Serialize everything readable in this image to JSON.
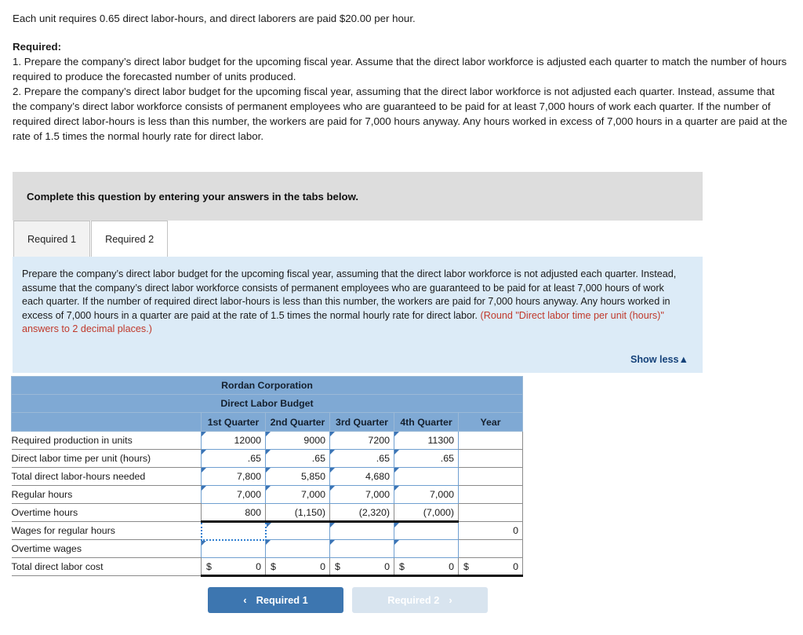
{
  "problem": {
    "intro": "Each unit requires 0.65 direct labor-hours, and direct laborers are paid $20.00 per hour.",
    "required_heading": "Required:",
    "req1": "1. Prepare the company’s direct labor budget for the upcoming fiscal year. Assume that the direct labor workforce is adjusted each quarter to match the number of hours required to produce the forecasted number of units produced.",
    "req2": "2. Prepare the company’s direct labor budget for the upcoming fiscal year, assuming that the direct labor workforce is not adjusted each quarter. Instead, assume that the company’s direct labor workforce consists of permanent employees who are guaranteed to be paid for at least 7,000 hours of work each quarter. If the number of required direct labor-hours is less than this number, the workers are paid for 7,000 hours anyway. Any hours worked in excess of 7,000 hours in a quarter are paid at the rate of 1.5 times the normal hourly rate for direct labor."
  },
  "banner": {
    "text": "Complete this question by entering your answers in the tabs below."
  },
  "tabs": [
    {
      "label": "Required 1",
      "active": false
    },
    {
      "label": "Required 2",
      "active": true
    }
  ],
  "instruction": {
    "body": "Prepare the company’s direct labor budget for the upcoming fiscal year, assuming that the direct labor workforce is not adjusted each quarter. Instead, assume that the company’s direct labor workforce consists of permanent employees who are guaranteed to be paid for at least 7,000 hours of work each quarter. If the number of required direct labor-hours is less than this number, the workers are paid for 7,000 hours anyway. Any hours worked in excess of 7,000 hours in a quarter are paid at the rate of 1.5 times the normal hourly rate for direct labor. ",
    "note": "(Round \"Direct labor time per unit (hours)\" answers to 2 decimal places.)",
    "show_less_label": "Show less▲"
  },
  "table": {
    "company": "Rordan Corporation",
    "title": "Direct Labor Budget",
    "columns": [
      "1st Quarter",
      "2nd Quarter",
      "3rd Quarter",
      "4th Quarter",
      "Year"
    ],
    "rows": [
      {
        "label": "Required production in units",
        "cells": [
          "12000",
          "9000",
          "7200",
          "11300",
          ""
        ]
      },
      {
        "label": "Direct labor time per unit (hours)",
        "cells": [
          ".65",
          ".65",
          ".65",
          ".65",
          ""
        ]
      },
      {
        "label": "Total direct labor-hours needed",
        "cells": [
          "7,800",
          "5,850",
          "4,680",
          "",
          ""
        ]
      },
      {
        "label": "Regular hours",
        "cells": [
          "7,000",
          "7,000",
          "7,000",
          "7,000",
          ""
        ]
      },
      {
        "label": "Overtime hours",
        "cells": [
          "800",
          "(1,150)",
          "(2,320)",
          "(7,000)",
          ""
        ]
      },
      {
        "label": "Wages for regular hours",
        "cells": [
          "",
          "",
          "",
          "",
          "0"
        ]
      },
      {
        "label": "Overtime wages",
        "cells": [
          "",
          "",
          "",
          "",
          ""
        ]
      },
      {
        "label": "Total direct labor cost",
        "cells": [
          "0",
          "0",
          "0",
          "0",
          "0"
        ],
        "dollar": "$"
      }
    ]
  },
  "footer": {
    "prev_label": "Required 1",
    "next_label": "Required 2",
    "prev_chevron": "‹",
    "next_chevron": "›"
  },
  "colors": {
    "header_blue": "#7fa9d4",
    "panel_blue": "#dcebf7",
    "banner_gray": "#dddddd",
    "accent_button": "#3d76b0",
    "note_red": "#c0392b",
    "link_navy": "#15427a"
  }
}
